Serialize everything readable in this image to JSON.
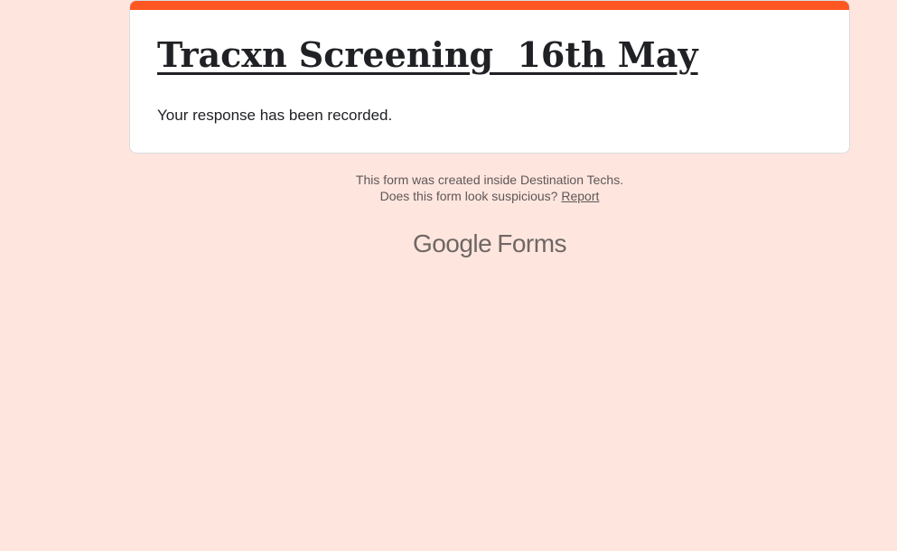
{
  "form": {
    "title": "Tracxn Screening  16th May",
    "confirmation": "Your response has been recorded."
  },
  "footer": {
    "created_inside": "This form was created inside Destination Techs.",
    "suspicious_prefix": "Does this form look suspicious? ",
    "report_label": "Report"
  },
  "branding": {
    "google": "Google",
    "forms": "Forms"
  },
  "colors": {
    "background": "#fee6df",
    "accent": "#ff5722",
    "card": "#ffffff"
  }
}
